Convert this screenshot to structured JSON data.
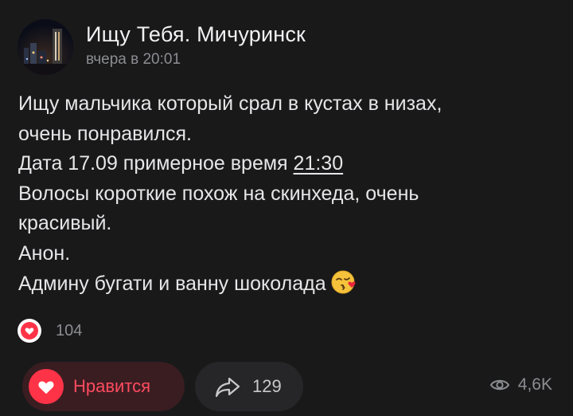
{
  "header": {
    "title": "Ищу Тебя. Мичуринск",
    "subtitle": "вчера в 20:01"
  },
  "post": {
    "lines": [
      "Ищу мальчика который срал в кустах в низах,",
      "очень понравился.",
      "Дата 17.09 примерное время ",
      "Волосы короткие похож на скинхеда, очень",
      "красивый.",
      "Анон.",
      "Админу бугати и ванну шоколада"
    ],
    "time_link": "21:30",
    "emoji": "kissing-face-with-heart-icon"
  },
  "reactions": {
    "count": "104",
    "icon": "heart-icon"
  },
  "actions": {
    "like_label": "Нравится",
    "share_count": "129",
    "views_count": "4,6K"
  },
  "colors": {
    "background": "#19191a",
    "like_accent": "#ff3347",
    "muted": "#8c8d91"
  }
}
